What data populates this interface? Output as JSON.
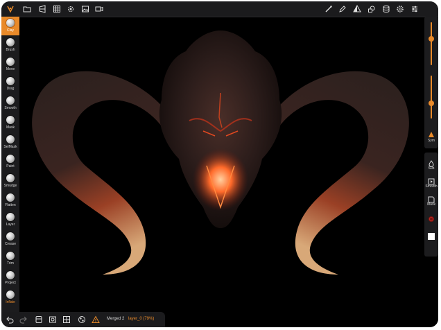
{
  "toolbar_top": {
    "icons_left": [
      "app-logo-icon",
      "folder-icon",
      "camera-view-icon",
      "grid-icon",
      "gear-icon",
      "image-icon",
      "video-icon"
    ],
    "icons_right": [
      "brush-icon",
      "pen-icon",
      "symmetry-icon",
      "shapes-icon",
      "layers-icon",
      "settings-icon",
      "sliders-icon"
    ]
  },
  "tools": [
    {
      "label": "Clay",
      "active": true
    },
    {
      "label": "Brush"
    },
    {
      "label": "Move"
    },
    {
      "label": "Drag"
    },
    {
      "label": "Smooth"
    },
    {
      "label": "Mask"
    },
    {
      "label": "SelMask"
    },
    {
      "label": "Paint"
    },
    {
      "label": "Smudge"
    },
    {
      "label": "Flatten"
    },
    {
      "label": "Layer"
    },
    {
      "label": "Crease"
    },
    {
      "label": "Trim"
    },
    {
      "label": "Project"
    },
    {
      "label": "Inflate",
      "alt": true
    }
  ],
  "right_panel": {
    "radius_value": 0.62,
    "intensity_value": 0.35,
    "sym_label": "Sym",
    "sub_label": "Sub",
    "smooth_label": "Smooth",
    "mask_label": "Mask"
  },
  "bottom_bar": {
    "status_text": "Merged 2",
    "layer_text": "layer_0 (79%)"
  },
  "colors": {
    "accent": "#e98a2a",
    "panel": "#1c1c1e",
    "background": "#000000"
  }
}
